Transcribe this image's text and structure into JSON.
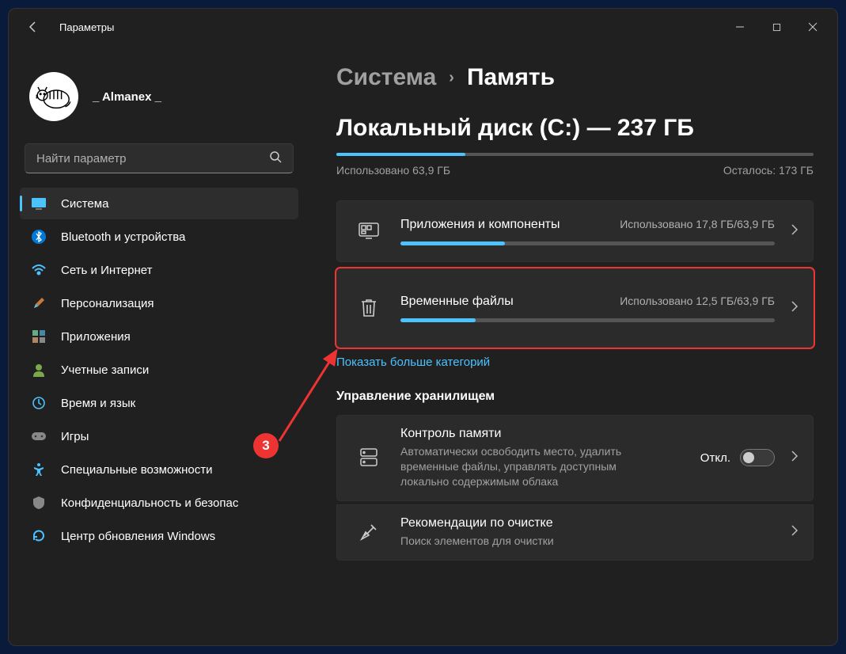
{
  "app_title": "Параметры",
  "user": {
    "name": "_ Almanex _"
  },
  "search": {
    "placeholder": "Найти параметр"
  },
  "sidebar": {
    "items": [
      {
        "label": "Система"
      },
      {
        "label": "Bluetooth и устройства"
      },
      {
        "label": "Сеть и Интернет"
      },
      {
        "label": "Персонализация"
      },
      {
        "label": "Приложения"
      },
      {
        "label": "Учетные записи"
      },
      {
        "label": "Время и язык"
      },
      {
        "label": "Игры"
      },
      {
        "label": "Специальные возможности"
      },
      {
        "label": "Конфиденциальность и безопас"
      },
      {
        "label": "Центр обновления Windows"
      }
    ]
  },
  "breadcrumb": {
    "parent": "Система",
    "current": "Память"
  },
  "disk": {
    "title": "Локальный диск (C:) — 237 ГБ",
    "used_label": "Использовано 63,9 ГБ",
    "free_label": "Осталось: 173 ГБ",
    "used_pct": 27
  },
  "categories": [
    {
      "title": "Приложения и компоненты",
      "usage": "Использовано 17,8 ГБ/63,9 ГБ",
      "pct": 28
    },
    {
      "title": "Временные файлы",
      "usage": "Использовано 12,5 ГБ/63,9 ГБ",
      "pct": 20
    }
  ],
  "show_more": "Показать больше категорий",
  "mgmt_heading": "Управление хранилищем",
  "mgmt": [
    {
      "title": "Контроль памяти",
      "desc": "Автоматически освободить место, удалить временные файлы, управлять доступным локально содержимым облака",
      "toggle_label": "Откл."
    },
    {
      "title": "Рекомендации по очистке",
      "desc": "Поиск элементов для очистки"
    }
  ],
  "annotation": {
    "number": "3"
  }
}
